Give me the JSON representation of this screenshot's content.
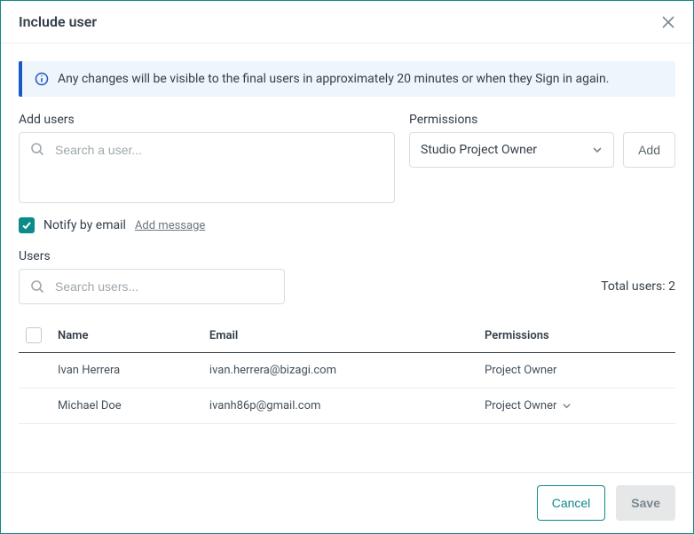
{
  "header": {
    "title": "Include user"
  },
  "banner": {
    "text": "Any changes will be visible to the final users in approximately 20 minutes or when they Sign in again."
  },
  "add": {
    "label": "Add users",
    "placeholder": "Search a user..."
  },
  "permissions": {
    "label": "Permissions",
    "selected": "Studio Project Owner",
    "add_button": "Add"
  },
  "notify": {
    "checked": true,
    "label": "Notify by email",
    "add_message": "Add message"
  },
  "users": {
    "label": "Users",
    "search_placeholder": "Search users...",
    "total_label": "Total users: 2",
    "columns": {
      "name": "Name",
      "email": "Email",
      "permissions": "Permissions"
    },
    "rows": [
      {
        "name": "Ivan Herrera",
        "email": "ivan.herrera@bizagi.com",
        "permission": "Project Owner",
        "editable_perm": false
      },
      {
        "name": "Michael Doe",
        "email": "ivanh86p@gmail.com",
        "permission": "Project Owner",
        "editable_perm": true
      }
    ]
  },
  "footer": {
    "cancel": "Cancel",
    "save": "Save"
  }
}
